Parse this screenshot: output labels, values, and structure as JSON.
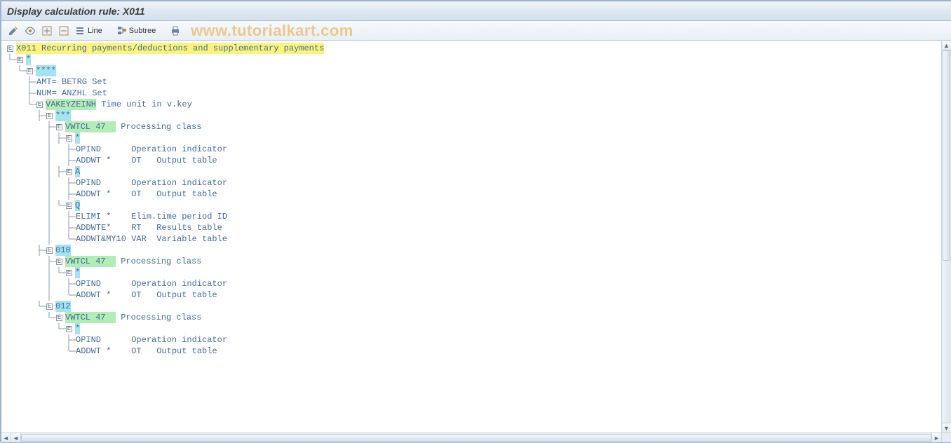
{
  "title": "Display calculation rule: X011",
  "toolbar": {
    "line_label": "Line",
    "subtree_label": "Subtree"
  },
  "watermark": "www.tutorialkart.com",
  "marker": "E",
  "tree": [
    {
      "depth": 0,
      "last": true,
      "text": [
        "X011 Recurring payments/deductions and supplementary payments"
      ],
      "hl": [
        "yellow"
      ],
      "expand": true
    },
    {
      "depth": 1,
      "last": true,
      "text": [
        "*"
      ],
      "hl": [
        "blue"
      ],
      "expand": true
    },
    {
      "depth": 2,
      "last": true,
      "text": [
        "****"
      ],
      "hl": [
        "blue"
      ],
      "expand": true
    },
    {
      "depth": 3,
      "last": false,
      "text": [
        "AMT= BETRG",
        " Set"
      ],
      "hl": [
        null,
        null
      ]
    },
    {
      "depth": 3,
      "last": false,
      "text": [
        "NUM= ANZHL",
        " Set"
      ],
      "hl": [
        null,
        null
      ]
    },
    {
      "depth": 3,
      "last": true,
      "text": [
        "VAKEYZEINH",
        " Time unit in v.key"
      ],
      "hl": [
        "green",
        null
      ],
      "expand": true
    },
    {
      "depth": 4,
      "last": false,
      "text": [
        "***"
      ],
      "hl": [
        "blue"
      ],
      "expand": true
    },
    {
      "depth": 5,
      "last": true,
      "text": [
        "VWTCL 47  ",
        " Processing class"
      ],
      "hl": [
        "green",
        null
      ],
      "expand": true
    },
    {
      "depth": 6,
      "last": false,
      "text": [
        "*"
      ],
      "hl": [
        "blue"
      ],
      "expand": true
    },
    {
      "depth": 7,
      "last": false,
      "text": [
        "OPIND     ",
        " Operation indicator"
      ],
      "hl": [
        null,
        null
      ]
    },
    {
      "depth": 7,
      "last": true,
      "text": [
        "ADDWT *   ",
        " OT   Output table"
      ],
      "hl": [
        null,
        null
      ],
      "siblingAfter": true
    },
    {
      "depth": 6,
      "last": false,
      "text": [
        "A"
      ],
      "hl": [
        "blue"
      ],
      "expand": true
    },
    {
      "depth": 7,
      "last": false,
      "text": [
        "OPIND     ",
        " Operation indicator"
      ],
      "hl": [
        null,
        null
      ]
    },
    {
      "depth": 7,
      "last": true,
      "text": [
        "ADDWT *   ",
        " OT   Output table"
      ],
      "hl": [
        null,
        null
      ],
      "siblingAfter": true
    },
    {
      "depth": 6,
      "last": true,
      "text": [
        "Q"
      ],
      "hl": [
        "blue"
      ],
      "expand": true
    },
    {
      "depth": 7,
      "last": false,
      "text": [
        "ELIMI *   ",
        " Elim.time period ID"
      ],
      "hl": [
        null,
        null
      ]
    },
    {
      "depth": 7,
      "last": false,
      "text": [
        "ADDWTE*   ",
        " RT   Results table"
      ],
      "hl": [
        null,
        null
      ]
    },
    {
      "depth": 7,
      "last": true,
      "text": [
        "ADDWT&MY10",
        " VAR  Variable table"
      ],
      "hl": [
        null,
        null
      ],
      "siblingAfter": true
    },
    {
      "depth": 4,
      "last": false,
      "text": [
        "010"
      ],
      "hl": [
        "blue"
      ],
      "expand": true
    },
    {
      "depth": 5,
      "last": true,
      "text": [
        "VWTCL 47  ",
        " Processing class"
      ],
      "hl": [
        "green",
        null
      ],
      "expand": true
    },
    {
      "depth": 6,
      "last": true,
      "text": [
        "*"
      ],
      "hl": [
        "blue"
      ],
      "expand": true
    },
    {
      "depth": 7,
      "last": false,
      "text": [
        "OPIND     ",
        " Operation indicator"
      ],
      "hl": [
        null,
        null
      ]
    },
    {
      "depth": 7,
      "last": true,
      "text": [
        "ADDWT *   ",
        " OT   Output table"
      ],
      "hl": [
        null,
        null
      ],
      "siblingAfter": true
    },
    {
      "depth": 4,
      "last": true,
      "text": [
        "012"
      ],
      "hl": [
        "blue"
      ],
      "expand": true
    },
    {
      "depth": 5,
      "last": true,
      "text": [
        "VWTCL 47  ",
        " Processing class"
      ],
      "hl": [
        "green",
        null
      ],
      "expand": true
    },
    {
      "depth": 6,
      "last": true,
      "text": [
        "*"
      ],
      "hl": [
        "blue"
      ],
      "expand": true
    },
    {
      "depth": 7,
      "last": false,
      "text": [
        "OPIND     ",
        " Operation indicator"
      ],
      "hl": [
        null,
        null
      ]
    },
    {
      "depth": 7,
      "last": true,
      "text": [
        "ADDWT *   ",
        " OT   Output table"
      ],
      "hl": [
        null,
        null
      ]
    }
  ]
}
